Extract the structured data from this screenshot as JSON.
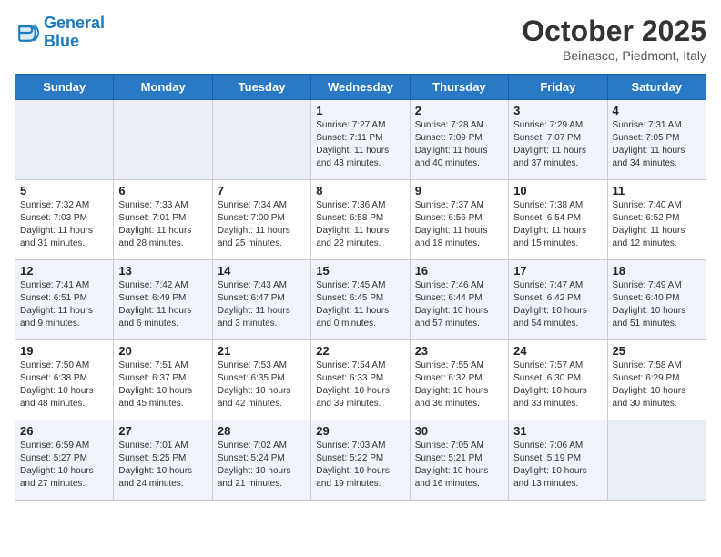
{
  "header": {
    "logo_line1": "General",
    "logo_line2": "Blue",
    "month": "October 2025",
    "location": "Beinasco, Piedmont, Italy"
  },
  "weekdays": [
    "Sunday",
    "Monday",
    "Tuesday",
    "Wednesday",
    "Thursday",
    "Friday",
    "Saturday"
  ],
  "weeks": [
    [
      {
        "day": "",
        "info": ""
      },
      {
        "day": "",
        "info": ""
      },
      {
        "day": "",
        "info": ""
      },
      {
        "day": "1",
        "info": "Sunrise: 7:27 AM\nSunset: 7:11 PM\nDaylight: 11 hours\nand 43 minutes."
      },
      {
        "day": "2",
        "info": "Sunrise: 7:28 AM\nSunset: 7:09 PM\nDaylight: 11 hours\nand 40 minutes."
      },
      {
        "day": "3",
        "info": "Sunrise: 7:29 AM\nSunset: 7:07 PM\nDaylight: 11 hours\nand 37 minutes."
      },
      {
        "day": "4",
        "info": "Sunrise: 7:31 AM\nSunset: 7:05 PM\nDaylight: 11 hours\nand 34 minutes."
      }
    ],
    [
      {
        "day": "5",
        "info": "Sunrise: 7:32 AM\nSunset: 7:03 PM\nDaylight: 11 hours\nand 31 minutes."
      },
      {
        "day": "6",
        "info": "Sunrise: 7:33 AM\nSunset: 7:01 PM\nDaylight: 11 hours\nand 28 minutes."
      },
      {
        "day": "7",
        "info": "Sunrise: 7:34 AM\nSunset: 7:00 PM\nDaylight: 11 hours\nand 25 minutes."
      },
      {
        "day": "8",
        "info": "Sunrise: 7:36 AM\nSunset: 6:58 PM\nDaylight: 11 hours\nand 22 minutes."
      },
      {
        "day": "9",
        "info": "Sunrise: 7:37 AM\nSunset: 6:56 PM\nDaylight: 11 hours\nand 18 minutes."
      },
      {
        "day": "10",
        "info": "Sunrise: 7:38 AM\nSunset: 6:54 PM\nDaylight: 11 hours\nand 15 minutes."
      },
      {
        "day": "11",
        "info": "Sunrise: 7:40 AM\nSunset: 6:52 PM\nDaylight: 11 hours\nand 12 minutes."
      }
    ],
    [
      {
        "day": "12",
        "info": "Sunrise: 7:41 AM\nSunset: 6:51 PM\nDaylight: 11 hours\nand 9 minutes."
      },
      {
        "day": "13",
        "info": "Sunrise: 7:42 AM\nSunset: 6:49 PM\nDaylight: 11 hours\nand 6 minutes."
      },
      {
        "day": "14",
        "info": "Sunrise: 7:43 AM\nSunset: 6:47 PM\nDaylight: 11 hours\nand 3 minutes."
      },
      {
        "day": "15",
        "info": "Sunrise: 7:45 AM\nSunset: 6:45 PM\nDaylight: 11 hours\nand 0 minutes."
      },
      {
        "day": "16",
        "info": "Sunrise: 7:46 AM\nSunset: 6:44 PM\nDaylight: 10 hours\nand 57 minutes."
      },
      {
        "day": "17",
        "info": "Sunrise: 7:47 AM\nSunset: 6:42 PM\nDaylight: 10 hours\nand 54 minutes."
      },
      {
        "day": "18",
        "info": "Sunrise: 7:49 AM\nSunset: 6:40 PM\nDaylight: 10 hours\nand 51 minutes."
      }
    ],
    [
      {
        "day": "19",
        "info": "Sunrise: 7:50 AM\nSunset: 6:38 PM\nDaylight: 10 hours\nand 48 minutes."
      },
      {
        "day": "20",
        "info": "Sunrise: 7:51 AM\nSunset: 6:37 PM\nDaylight: 10 hours\nand 45 minutes."
      },
      {
        "day": "21",
        "info": "Sunrise: 7:53 AM\nSunset: 6:35 PM\nDaylight: 10 hours\nand 42 minutes."
      },
      {
        "day": "22",
        "info": "Sunrise: 7:54 AM\nSunset: 6:33 PM\nDaylight: 10 hours\nand 39 minutes."
      },
      {
        "day": "23",
        "info": "Sunrise: 7:55 AM\nSunset: 6:32 PM\nDaylight: 10 hours\nand 36 minutes."
      },
      {
        "day": "24",
        "info": "Sunrise: 7:57 AM\nSunset: 6:30 PM\nDaylight: 10 hours\nand 33 minutes."
      },
      {
        "day": "25",
        "info": "Sunrise: 7:58 AM\nSunset: 6:29 PM\nDaylight: 10 hours\nand 30 minutes."
      }
    ],
    [
      {
        "day": "26",
        "info": "Sunrise: 6:59 AM\nSunset: 5:27 PM\nDaylight: 10 hours\nand 27 minutes."
      },
      {
        "day": "27",
        "info": "Sunrise: 7:01 AM\nSunset: 5:25 PM\nDaylight: 10 hours\nand 24 minutes."
      },
      {
        "day": "28",
        "info": "Sunrise: 7:02 AM\nSunset: 5:24 PM\nDaylight: 10 hours\nand 21 minutes."
      },
      {
        "day": "29",
        "info": "Sunrise: 7:03 AM\nSunset: 5:22 PM\nDaylight: 10 hours\nand 19 minutes."
      },
      {
        "day": "30",
        "info": "Sunrise: 7:05 AM\nSunset: 5:21 PM\nDaylight: 10 hours\nand 16 minutes."
      },
      {
        "day": "31",
        "info": "Sunrise: 7:06 AM\nSunset: 5:19 PM\nDaylight: 10 hours\nand 13 minutes."
      },
      {
        "day": "",
        "info": ""
      }
    ]
  ]
}
